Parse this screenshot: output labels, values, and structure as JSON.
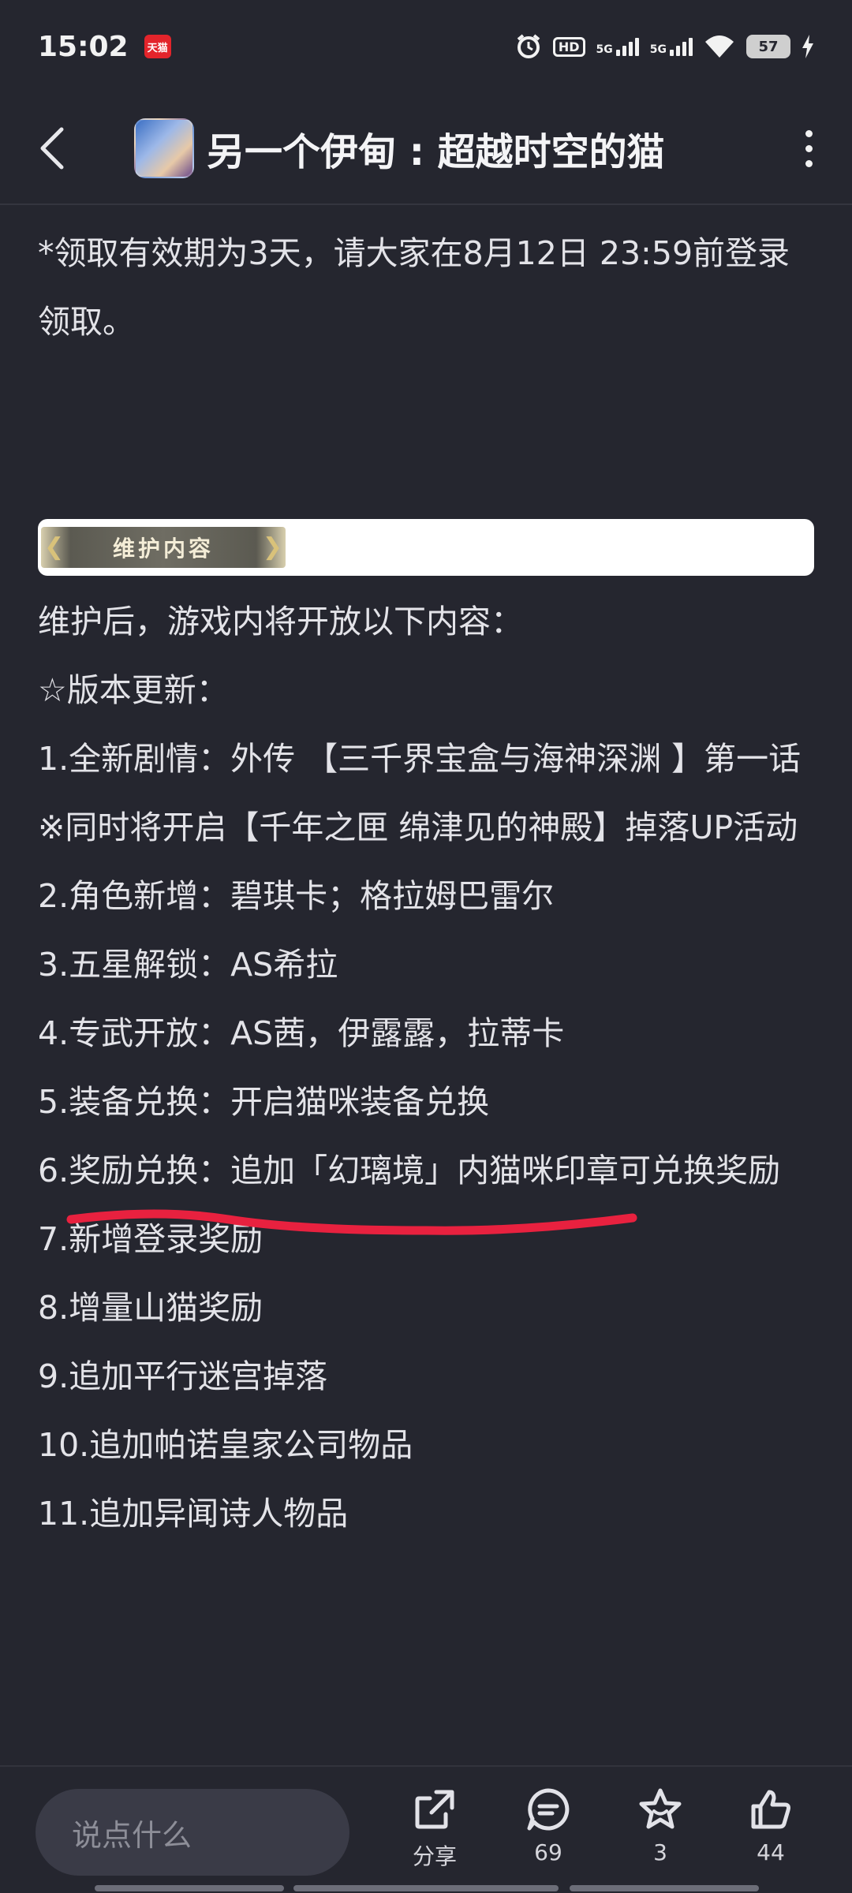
{
  "status_bar": {
    "time": "15:02",
    "notification_badge": "天猫",
    "hd_label": "HD",
    "network_1": "5G",
    "network_2": "5G",
    "battery": "57"
  },
  "header": {
    "title": "另一个伊甸 : 超越时空的猫",
    "icons": [
      "back-arrow-icon",
      "game-app-icon",
      "more-vertical-icon"
    ]
  },
  "article": {
    "notice": "*领取有效期为3天，请大家在8月12日 23:59前登录领取。",
    "banner_label": "维护内容",
    "intro": "维护后，游戏内将开放以下内容：",
    "section_title": "☆版本更新：",
    "items": [
      "1.全新剧情：外传 【三千界宝盒与海神深渊 】第一话",
      "※同时将开启【千年之匣 绵津见的神殿】掉落UP活动",
      "2.角色新增：碧琪卡；格拉姆巴雷尔",
      "3.五星解锁：AS希拉",
      "4.专武开放：AS茜，伊露露，拉蒂卡",
      "5.装备兑换：开启猫咪装备兑换",
      "6.奖励兑换：追加「幻璃境」内猫咪印章可兑换奖励",
      "7.新增登录奖励",
      "8.增量山猫奖励",
      "9.追加平行迷宫掉落",
      "10.追加帕诺皇家公司物品",
      "11.追加异闻诗人物品"
    ],
    "highlight_color": "#e8213f"
  },
  "bottom_bar": {
    "comment_placeholder": "说点什么",
    "share_label": "分享",
    "comment_count": "69",
    "favorite_count": "3",
    "like_count": "44"
  },
  "colors": {
    "background": "#25262f",
    "text": "#e3e3e8",
    "input_bg": "#3a3b47"
  }
}
